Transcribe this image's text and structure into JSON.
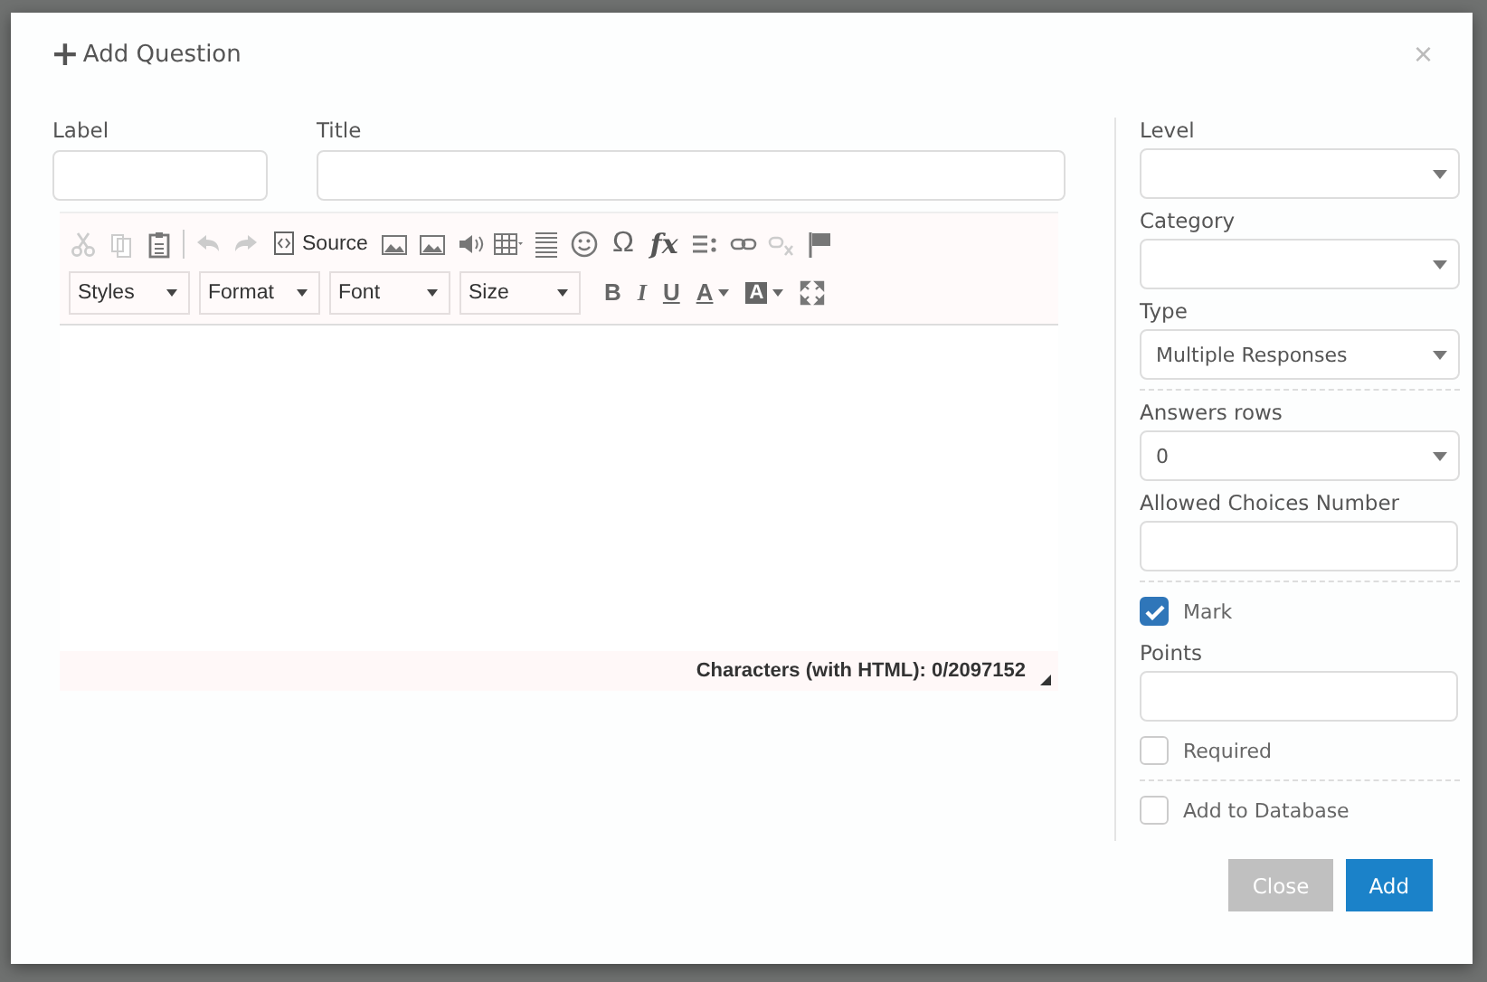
{
  "dialog": {
    "title": "Add Question",
    "title_glyph": "+",
    "close_glyph": "×"
  },
  "left_fields": [
    {
      "label": "Label",
      "kind": "short"
    },
    {
      "label": "Title",
      "kind": "wide"
    }
  ],
  "editor": {
    "toolbar": [
      {
        "kind": "cut",
        "disabled": true
      },
      {
        "kind": "copy",
        "disabled": true
      },
      {
        "kind": "paste",
        "disabled": false
      },
      {
        "kind": "separator"
      },
      {
        "kind": "undo",
        "disabled": true
      },
      {
        "kind": "redo",
        "disabled": true
      },
      {
        "kind": "source",
        "label": "Source",
        "disabled": false
      },
      {
        "kind": "image",
        "disabled": false
      },
      {
        "kind": "image",
        "disabled": false
      },
      {
        "kind": "audio",
        "disabled": false
      },
      {
        "kind": "table",
        "disabled": false
      },
      {
        "kind": "rule",
        "disabled": false
      },
      {
        "kind": "smiley",
        "disabled": false
      },
      {
        "kind": "glyph",
        "label": "Ω",
        "disabled": false
      },
      {
        "kind": "formula",
        "label": "fx",
        "disabled": false
      },
      {
        "kind": "list",
        "disabled": false
      },
      {
        "kind": "link",
        "disabled": false
      },
      {
        "kind": "unlink",
        "disabled": true
      },
      {
        "kind": "flag",
        "disabled": false
      }
    ],
    "combos": [
      "Styles",
      "Format",
      "Font",
      "Size"
    ],
    "format_buttons": [
      {
        "kind": "bold",
        "label": "B"
      },
      {
        "kind": "italic",
        "label": "I"
      },
      {
        "kind": "underline",
        "label": "U"
      },
      {
        "kind": "text-color",
        "label": "A"
      },
      {
        "kind": "bg-color",
        "label": "A"
      },
      {
        "kind": "maximize"
      }
    ],
    "counter": "Characters (with HTML): 0/2097152"
  },
  "side_fields": [
    {
      "kind": "select",
      "label": "Level"
    },
    {
      "kind": "select",
      "label": "Category"
    },
    {
      "kind": "select",
      "label": "Type",
      "value": "Multiple Responses"
    },
    {
      "kind": "divider"
    },
    {
      "kind": "select",
      "label": "Answers rows",
      "value": "0"
    },
    {
      "kind": "input",
      "label": "Allowed Choices Number"
    },
    {
      "kind": "divider"
    },
    {
      "kind": "checkbox",
      "label": "Mark",
      "checked": true
    },
    {
      "kind": "input",
      "label": "Points"
    },
    {
      "kind": "checkbox",
      "label": "Required",
      "checked": false
    },
    {
      "kind": "divider"
    },
    {
      "kind": "checkbox",
      "label": "Add to Database",
      "checked": false
    }
  ],
  "buttons": [
    {
      "kind": "secondary",
      "label": "Close"
    },
    {
      "kind": "primary",
      "label": "Add"
    }
  ]
}
